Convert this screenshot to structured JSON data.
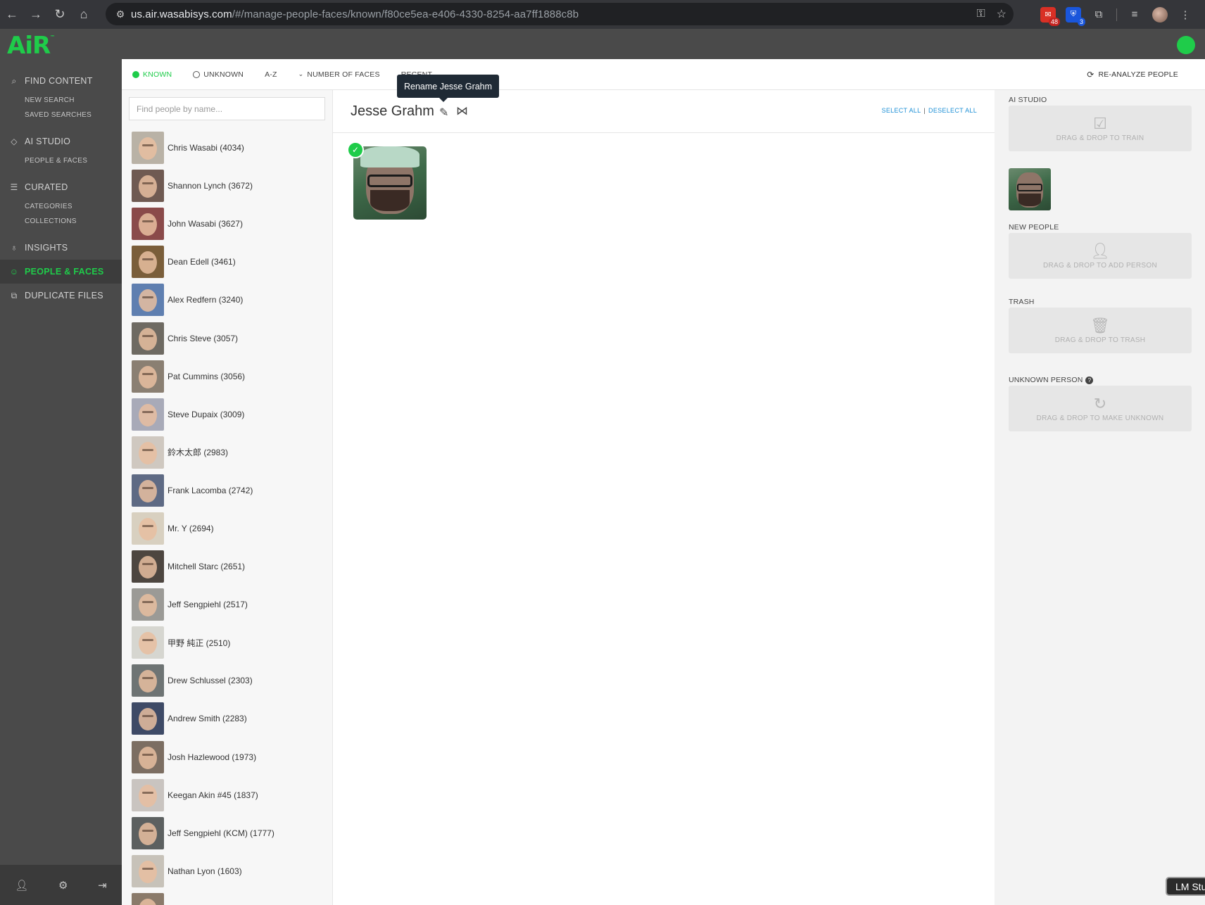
{
  "browser": {
    "url_host": "us.air.wasabisys.com",
    "url_path": "/#/manage-people-faces/known/f80ce5ea-e406-4330-8254-aa7ff1888c8b",
    "ext_badge_1": "48",
    "ext_badge_2": "3"
  },
  "app": {
    "logo": "AiR",
    "logo_tm": "™"
  },
  "nav": {
    "find_content": "FIND CONTENT",
    "new_search": "NEW SEARCH",
    "saved_searches": "SAVED SEARCHES",
    "ai_studio": "AI STUDIO",
    "people_faces_sub": "PEOPLE & FACES",
    "curated": "CURATED",
    "categories": "CATEGORIES",
    "collections": "COLLECTIONS",
    "insights": "INSIGHTS",
    "people_faces": "PEOPLE & FACES",
    "duplicate_files": "DUPLICATE FILES"
  },
  "filters": {
    "known": "KNOWN",
    "unknown": "UNKNOWN",
    "az": "A-Z",
    "number_of_faces": "NUMBER OF FACES",
    "recent": "RECENT",
    "reanalyze": "RE-ANALYZE PEOPLE"
  },
  "tooltip": "Rename Jesse Grahm",
  "search": {
    "placeholder": "Find people by name..."
  },
  "people": [
    {
      "label": "Chris Wasabi (4034)",
      "bg": "#b9b2a6"
    },
    {
      "label": "Shannon Lynch (3672)",
      "bg": "#6f5a52"
    },
    {
      "label": "John Wasabi (3627)",
      "bg": "#8a4a4a"
    },
    {
      "label": "Dean Edell (3461)",
      "bg": "#7a5e3a"
    },
    {
      "label": "Alex Redfern (3240)",
      "bg": "#5f7fb0"
    },
    {
      "label": "Chris Steve (3057)",
      "bg": "#6e6a62"
    },
    {
      "label": "Pat Cummins (3056)",
      "bg": "#8a7f72"
    },
    {
      "label": "Steve Dupaix (3009)",
      "bg": "#a8aab8"
    },
    {
      "label": "鈴木太郎 (2983)",
      "bg": "#cfc8c0"
    },
    {
      "label": "Frank Lacomba (2742)",
      "bg": "#5e6a84"
    },
    {
      "label": "Mr. Y (2694)",
      "bg": "#d8d0c0"
    },
    {
      "label": "Mitchell Starc (2651)",
      "bg": "#4d4640"
    },
    {
      "label": "Jeff Sengpiehl (2517)",
      "bg": "#9b9a96"
    },
    {
      "label": "甲野 純正 (2510)",
      "bg": "#d6d6d0"
    },
    {
      "label": "Drew Schlussel (2303)",
      "bg": "#6e7474"
    },
    {
      "label": "Andrew Smith (2283)",
      "bg": "#3e4a66"
    },
    {
      "label": "Josh Hazlewood (1973)",
      "bg": "#7c6e62"
    },
    {
      "label": "Keegan Akin #45 (1837)",
      "bg": "#c9c4c0"
    },
    {
      "label": "Jeff Sengpiehl (KCM) (1777)",
      "bg": "#5c6060"
    },
    {
      "label": "Nathan Lyon (1603)",
      "bg": "#c7c2b9"
    },
    {
      "label": "",
      "bg": "#8a7a6a"
    }
  ],
  "main": {
    "title": "Jesse Grahm",
    "select_all": "SELECT ALL",
    "separator": "|",
    "deselect_all": "DESELECT ALL"
  },
  "right": {
    "ai_studio": "AI STUDIO",
    "drag_train": "DRAG & DROP TO TRAIN",
    "new_people": "NEW PEOPLE",
    "drag_add": "DRAG & DROP TO ADD PERSON",
    "trash": "TRASH",
    "drag_trash": "DRAG & DROP TO TRASH",
    "unknown_person": "UNKNOWN PERSON",
    "drag_unknown": "DRAG & DROP TO MAKE UNKNOWN"
  },
  "overlay": {
    "lm_badge": "LM Stu"
  },
  "colors": {
    "accent": "#1fcc4a",
    "link": "#1e90d6",
    "nav_bg": "#4a4a4a"
  }
}
